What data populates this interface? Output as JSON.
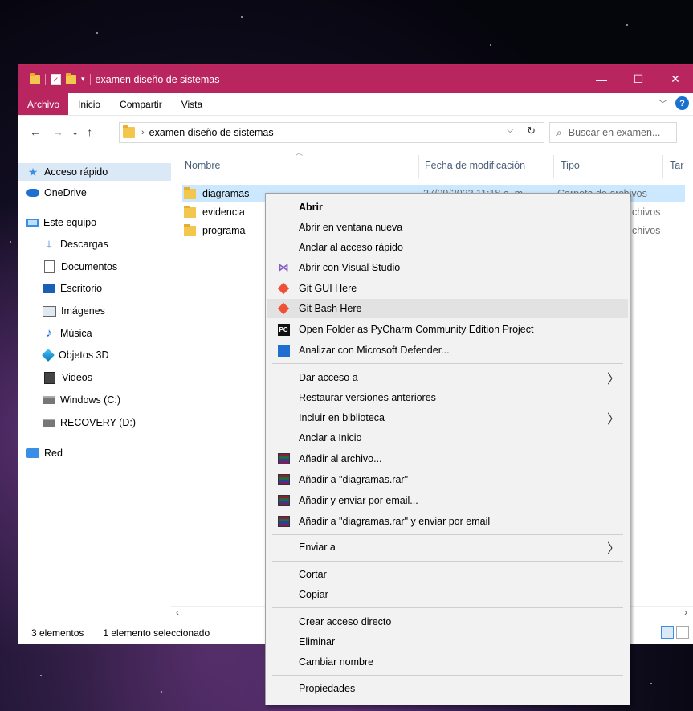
{
  "window": {
    "title": "examen diseño de sistemas",
    "controls": {
      "minimize": "—",
      "maximize": "☐",
      "close": "✕"
    }
  },
  "ribbon": {
    "tabs": [
      {
        "label": "Archivo",
        "active": true
      },
      {
        "label": "Inicio"
      },
      {
        "label": "Compartir"
      },
      {
        "label": "Vista"
      }
    ],
    "expand_icon": "﹀",
    "help": "?"
  },
  "address": {
    "back": "←",
    "forward": "→",
    "recent": "⌄",
    "up": "↑",
    "path": "examen diseño de sistemas",
    "search_placeholder": "Buscar en examen..."
  },
  "nav": {
    "items": [
      {
        "label": "Acceso rápido",
        "icon": "star-icon"
      },
      {
        "label": "OneDrive",
        "icon": "cloud-icon"
      },
      {
        "label": "Este equipo",
        "icon": "computer-icon"
      },
      {
        "label": "Descargas",
        "icon": "download-icon"
      },
      {
        "label": "Documentos",
        "icon": "document-icon"
      },
      {
        "label": "Escritorio",
        "icon": "desktop-icon"
      },
      {
        "label": "Imágenes",
        "icon": "image-icon"
      },
      {
        "label": "Música",
        "icon": "music-icon"
      },
      {
        "label": "Objetos 3D",
        "icon": "3d-objects-icon"
      },
      {
        "label": "Videos",
        "icon": "video-icon"
      },
      {
        "label": "Windows (C:)",
        "icon": "drive-icon"
      },
      {
        "label": "RECOVERY (D:)",
        "icon": "drive-icon"
      },
      {
        "label": "Red",
        "icon": "network-icon"
      }
    ]
  },
  "files": {
    "columns": {
      "name": "Nombre",
      "date": "Fecha de modificación",
      "type": "Tipo",
      "size": "Tar"
    },
    "rows": [
      {
        "name": "diagramas",
        "date": "27/09/2022 11:18 a. m.",
        "type": "Carpeta de archivos",
        "selected": true
      },
      {
        "name": "evidencia",
        "type_partial": "chivos"
      },
      {
        "name": "programa",
        "type_partial": "chivos"
      }
    ]
  },
  "status": {
    "count": "3 elementos",
    "selection": "1 elemento seleccionado"
  },
  "context_menu": {
    "items": [
      {
        "label": "Abrir",
        "bold": true
      },
      {
        "label": "Abrir en ventana nueva"
      },
      {
        "label": "Anclar al acceso rápido"
      },
      {
        "label": "Abrir con Visual Studio",
        "icon": "visual-studio-icon"
      },
      {
        "label": "Git GUI Here",
        "icon": "git-icon"
      },
      {
        "label": "Git Bash Here",
        "icon": "git-icon",
        "highlighted": true
      },
      {
        "label": "Open Folder as PyCharm Community Edition Project",
        "icon": "pycharm-icon"
      },
      {
        "label": "Analizar con Microsoft Defender...",
        "icon": "defender-icon"
      },
      {
        "label": "Dar acceso a",
        "submenu": true
      },
      {
        "label": "Restaurar versiones anteriores"
      },
      {
        "label": "Incluir en biblioteca",
        "submenu": true
      },
      {
        "label": "Anclar a Inicio"
      },
      {
        "label": "Añadir al archivo...",
        "icon": "winrar-icon"
      },
      {
        "label": "Añadir a \"diagramas.rar\"",
        "icon": "winrar-icon"
      },
      {
        "label": "Añadir y enviar por email...",
        "icon": "winrar-icon"
      },
      {
        "label": "Añadir a \"diagramas.rar\" y enviar por email",
        "icon": "winrar-icon"
      },
      {
        "label": "Enviar a",
        "submenu": true
      },
      {
        "label": "Cortar"
      },
      {
        "label": "Copiar"
      },
      {
        "label": "Crear acceso directo"
      },
      {
        "label": "Eliminar"
      },
      {
        "label": "Cambiar nombre"
      },
      {
        "label": "Propiedades"
      }
    ]
  },
  "colors": {
    "accent": "#b9255f",
    "selection": "#cce8ff",
    "menu_bg": "#f2f2f2"
  }
}
